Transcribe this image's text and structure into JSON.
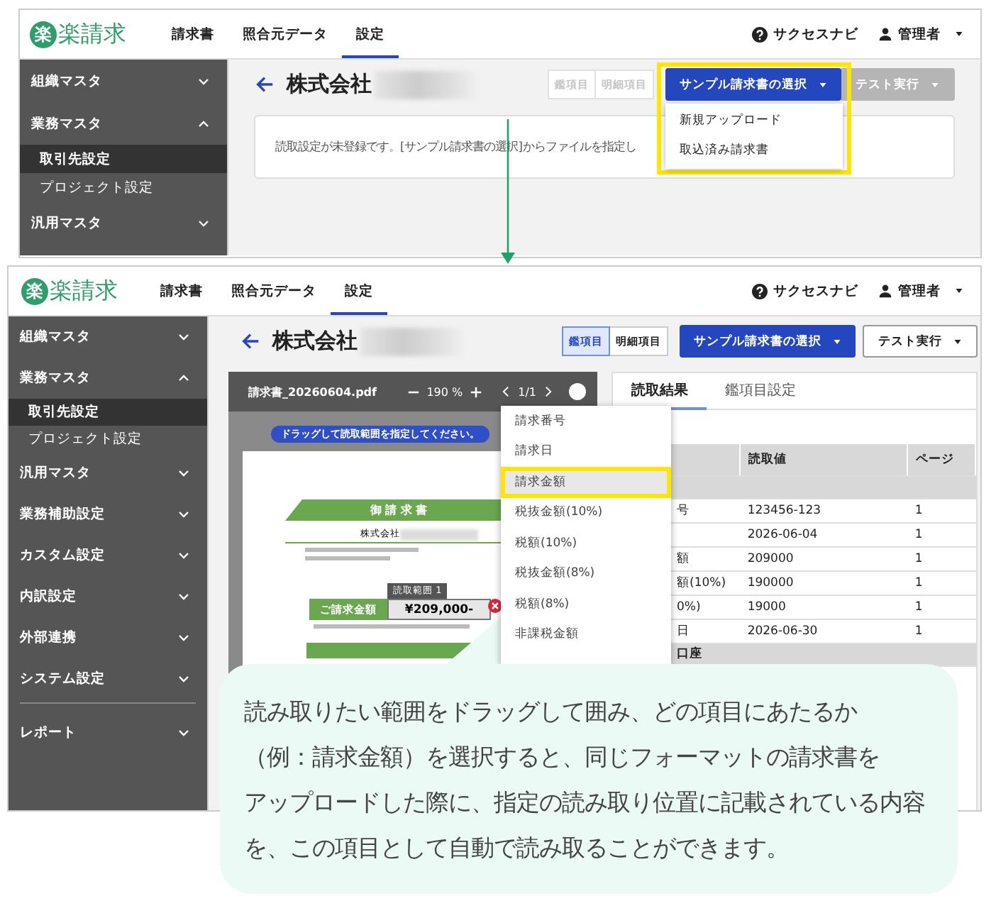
{
  "top_screen": {
    "header": {
      "logo_mark": "楽",
      "logo_text": "楽請求",
      "nav_tabs": [
        {
          "label": "請求書",
          "selected": false
        },
        {
          "label": "照合元データ",
          "selected": false
        },
        {
          "label": "設定",
          "selected": true
        }
      ],
      "help_link": "サクセスナビ",
      "user_menu": "管理者"
    },
    "sidebar": [
      {
        "kind": "section",
        "label": "組織マスタ",
        "expanded": false
      },
      {
        "kind": "section",
        "label": "業務マスタ",
        "expanded": true,
        "children": [
          {
            "label": "取引先設定",
            "selected": true
          },
          {
            "label": "プロジェクト設定",
            "selected": false
          }
        ]
      },
      {
        "kind": "section",
        "label": "汎用マスタ",
        "expanded": false
      }
    ],
    "page_title": "株式会社",
    "view_toggle": [
      {
        "label": "鑑項目",
        "selected": false,
        "disabled": true
      },
      {
        "label": "明細項目",
        "selected": false,
        "disabled": true
      }
    ],
    "sample_button": {
      "label": "サンプル請求書の選択",
      "highlighted": true
    },
    "sample_menu": [
      "新規アップロード",
      "取込済み請求書"
    ],
    "test_button": {
      "label": "テスト実行",
      "disabled": true
    },
    "notice": "読取設定が未登録です。[サンプル請求書の選択]からファイルを指定し"
  },
  "bottom_screen": {
    "header": {
      "logo_mark": "楽",
      "logo_text": "楽請求",
      "nav_tabs": [
        {
          "label": "請求書",
          "selected": false
        },
        {
          "label": "照合元データ",
          "selected": false
        },
        {
          "label": "設定",
          "selected": true
        }
      ],
      "help_link": "サクセスナビ",
      "user_menu": "管理者"
    },
    "sidebar": [
      {
        "kind": "section",
        "label": "組織マスタ",
        "expanded": false
      },
      {
        "kind": "section",
        "label": "業務マスタ",
        "expanded": true,
        "children": [
          {
            "label": "取引先設定",
            "selected": true
          },
          {
            "label": "プロジェクト設定",
            "selected": false
          }
        ]
      },
      {
        "kind": "section",
        "label": "汎用マスタ",
        "expanded": false
      },
      {
        "kind": "section",
        "label": "業務補助設定",
        "expanded": false
      },
      {
        "kind": "section",
        "label": "カスタム設定",
        "expanded": false
      },
      {
        "kind": "section",
        "label": "内訳設定",
        "expanded": false
      },
      {
        "kind": "section",
        "label": "外部連携",
        "expanded": false
      },
      {
        "kind": "section",
        "label": "システム設定",
        "expanded": false
      },
      {
        "kind": "divider"
      },
      {
        "kind": "section",
        "label": "レポート",
        "expanded": false
      }
    ],
    "page_title": "株式会社",
    "view_toggle": [
      {
        "label": "鑑項目",
        "selected": true,
        "disabled": false
      },
      {
        "label": "明細項目",
        "selected": false,
        "disabled": false
      }
    ],
    "sample_button": {
      "label": "サンプル請求書の選択"
    },
    "test_button": {
      "label": "テスト実行",
      "disabled": false
    },
    "viewer": {
      "file_name": "請求書_20260604.pdf",
      "zoom": "190 %",
      "page": "1/1",
      "hint": "ドラッグして読取範囲を指定してください。",
      "document": {
        "heading": "御 請 求 書",
        "company": "株式会社",
        "region_label": "読取範囲 1",
        "amount_label": "ご請求金額",
        "amount": "¥209,000-"
      }
    },
    "field_menu": [
      {
        "label": "請求番号",
        "selected": false,
        "highlighted": false
      },
      {
        "label": "請求日",
        "selected": false,
        "highlighted": false
      },
      {
        "label": "請求金額",
        "selected": true,
        "highlighted": true
      },
      {
        "label": "税抜金額(10%)",
        "selected": false,
        "highlighted": false
      },
      {
        "label": "税額(10%)",
        "selected": false,
        "highlighted": false
      },
      {
        "label": "税抜金額(8%)",
        "selected": false,
        "highlighted": false
      },
      {
        "label": "税額(8%)",
        "selected": false,
        "highlighted": false
      },
      {
        "label": "非課税金額",
        "selected": false,
        "highlighted": false
      }
    ],
    "result_tabs": [
      {
        "label": "読取結果",
        "selected": true
      },
      {
        "label": "鑑項目設定",
        "selected": false
      }
    ],
    "table": {
      "columns": [
        "読取値",
        "ページ"
      ],
      "rows": [
        {
          "kind": "group"
        },
        {
          "kind": "item",
          "column_1": "号",
          "value": "123456-123",
          "page": "1"
        },
        {
          "kind": "item",
          "value": "2026-06-04",
          "page": "1"
        },
        {
          "kind": "item",
          "column_1": "額",
          "value": "209000",
          "page": "1"
        },
        {
          "kind": "item",
          "column_1": "額(10%)",
          "value": "190000",
          "page": "1"
        },
        {
          "kind": "item",
          "column_1": "0%)",
          "value": "19000",
          "page": "1"
        },
        {
          "kind": "item",
          "column_1": "日",
          "value": "2026-06-30",
          "page": "1"
        },
        {
          "kind": "group",
          "label": "口座"
        }
      ]
    }
  },
  "callout": [
    "読み取りたい範囲をドラッグして囲み、どの項目にあたるか",
    "（例：請求金額）を選択すると、同じフォーマットの請求書を",
    "アップロードした際に、指定の読み取り位置に記載されている内容",
    "を、この項目として自動で読み取ることができます。"
  ]
}
